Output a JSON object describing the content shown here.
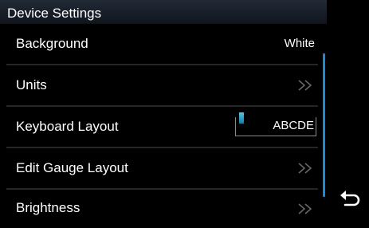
{
  "window": {
    "title": "Device Settings"
  },
  "menu": {
    "items": [
      {
        "label": "Background",
        "value": "White",
        "control": "value"
      },
      {
        "label": "Units",
        "control": "chevron"
      },
      {
        "label": "Keyboard Layout",
        "value": "ABCDE",
        "control": "keyboard-field"
      },
      {
        "label": "Edit Gauge Layout",
        "control": "chevron"
      },
      {
        "label": "Brightness",
        "control": "chevron"
      }
    ]
  },
  "icons": {
    "chevron": "double-chevron-right-icon",
    "back": "return-arrow-icon"
  },
  "colors": {
    "background": "#000000",
    "title_bar": "#1a202a",
    "accent_scrollbar": "#1e8ad6",
    "chevron": "#6a6a6a",
    "text": "#ffffff"
  }
}
